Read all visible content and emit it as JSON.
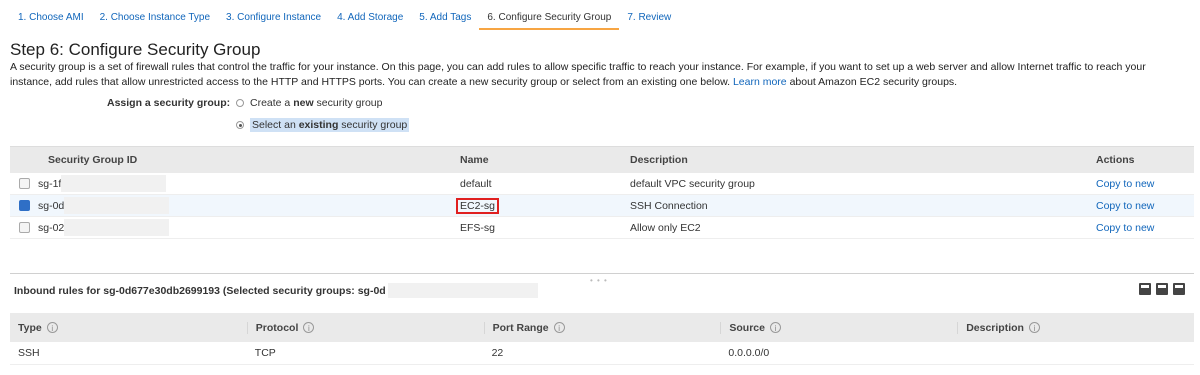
{
  "wizard": {
    "tabs": [
      "1. Choose AMI",
      "2. Choose Instance Type",
      "3. Configure Instance",
      "4. Add Storage",
      "5. Add Tags",
      "6. Configure Security Group",
      "7. Review"
    ],
    "active_index": 5
  },
  "page": {
    "title": "Step 6: Configure Security Group",
    "intro_text": "A security group is a set of firewall rules that control the traffic for your instance. On this page, you can add rules to allow specific traffic to reach your instance. For example, if you want to set up a web server and allow Internet traffic to reach your instance, add rules that allow unrestricted access to the HTTP and HTTPS ports. You can create a new security group or select from an existing one below.",
    "learn_more": "Learn more",
    "intro_suffix": "about Amazon EC2 security groups."
  },
  "assign": {
    "label": "Assign a security group:",
    "option_new_prefix": "Create a ",
    "option_new_bold": "new",
    "option_new_suffix": " security group",
    "option_existing_prefix": "Select an ",
    "option_existing_bold": "existing",
    "option_existing_suffix": " security group",
    "selected": "existing"
  },
  "sg_table": {
    "headers": {
      "id": "Security Group ID",
      "name": "Name",
      "description": "Description",
      "actions": "Actions"
    },
    "rows": [
      {
        "id": "sg-1f",
        "name": "default",
        "description": "default VPC security group",
        "action": "Copy to new",
        "checked": false
      },
      {
        "id": "sg-0d",
        "name": "EC2-sg",
        "description": "SSH Connection",
        "action": "Copy to new",
        "checked": true
      },
      {
        "id": "sg-02",
        "name": "EFS-sg",
        "description": "Allow only EC2",
        "action": "Copy to new",
        "checked": false
      }
    ]
  },
  "inbound": {
    "title": "Inbound rules for sg-0d677e30db2699193 (Selected security groups: sg-0d"
  },
  "rules_table": {
    "headers": [
      "Type",
      "Protocol",
      "Port Range",
      "Source",
      "Description"
    ],
    "rows": [
      [
        "SSH",
        "TCP",
        "22",
        "0.0.0.0/0",
        ""
      ]
    ]
  },
  "colors": {
    "link": "#1166bb",
    "active_tab_underline": "#f7a543",
    "highlight_box": "#e02020",
    "checkbox_checked": "#2f6fc6"
  }
}
